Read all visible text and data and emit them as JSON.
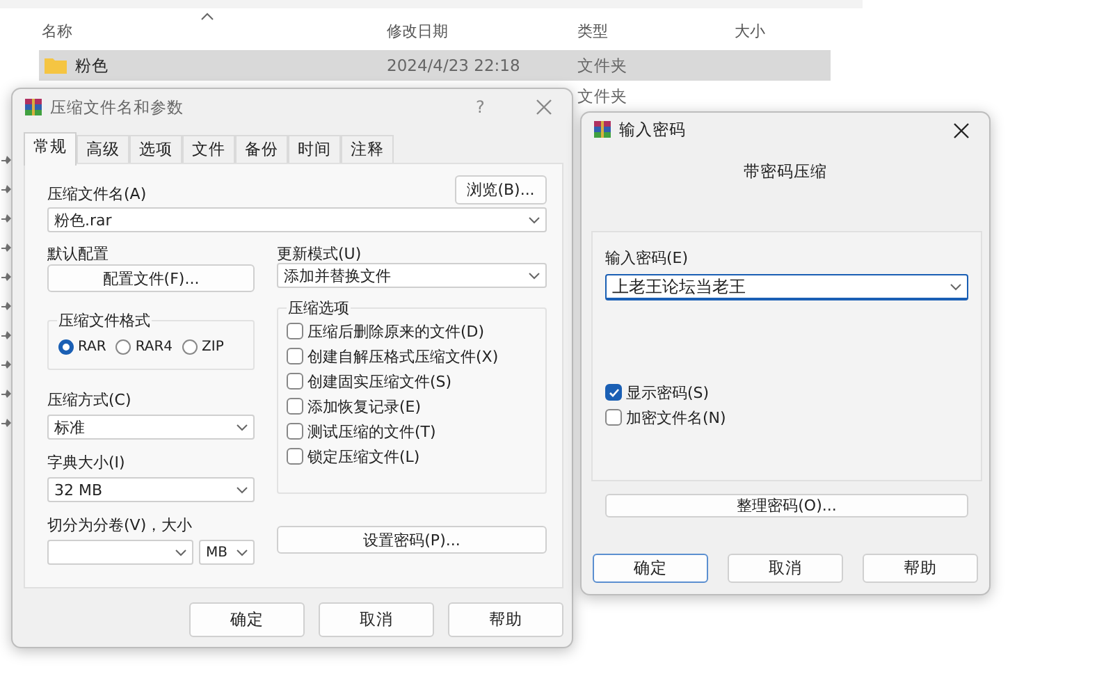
{
  "explorer": {
    "columns": [
      "名称",
      "修改日期",
      "类型",
      "大小"
    ],
    "rows": [
      {
        "name": "粉色",
        "modified": "2024/4/23 22:18",
        "type": "文件夹",
        "selected": true
      },
      {
        "type": "文件夹",
        "selected": false
      }
    ]
  },
  "archive_dialog": {
    "title": "压缩文件名和参数",
    "help_glyph": "?",
    "tabs": [
      {
        "label": "常规",
        "selected": true
      },
      {
        "label": "高级",
        "selected": false
      },
      {
        "label": "选项",
        "selected": false
      },
      {
        "label": "文件",
        "selected": false
      },
      {
        "label": "备份",
        "selected": false
      },
      {
        "label": "时间",
        "selected": false
      },
      {
        "label": "注释",
        "selected": false
      }
    ],
    "archive_name_label": "压缩文件名(A)",
    "browse_button": "浏览(B)...",
    "archive_name_value": "粉色.rar",
    "profile_label": "默认配置",
    "profile_button": "配置文件(F)...",
    "update_mode_label": "更新模式(U)",
    "update_mode_value": "添加并替换文件",
    "format_group": {
      "title": "压缩文件格式",
      "options": [
        {
          "label": "RAR",
          "selected": true
        },
        {
          "label": "RAR4",
          "selected": false
        },
        {
          "label": "ZIP",
          "selected": false
        }
      ]
    },
    "method_label": "压缩方式(C)",
    "method_value": "标准",
    "dictionary_label": "字典大小(I)",
    "dictionary_value": "32 MB",
    "split_label": "切分为分卷(V)，大小",
    "split_unit": "MB",
    "options_group": {
      "title": "压缩选项",
      "items": [
        {
          "label": "压缩后删除原来的文件(D)",
          "checked": false
        },
        {
          "label": "创建自解压格式压缩文件(X)",
          "checked": false
        },
        {
          "label": "创建固实压缩文件(S)",
          "checked": false
        },
        {
          "label": "添加恢复记录(E)",
          "checked": false
        },
        {
          "label": "测试压缩的文件(T)",
          "checked": false
        },
        {
          "label": "锁定压缩文件(L)",
          "checked": false
        }
      ]
    },
    "set_password_button": "设置密码(P)...",
    "buttons": [
      {
        "label": "确定",
        "focused": false
      },
      {
        "label": "取消",
        "focused": false
      },
      {
        "label": "帮助",
        "focused": false
      }
    ]
  },
  "password_dialog": {
    "title": "输入密码",
    "heading": "带密码压缩",
    "field_label": "输入密码(E)",
    "field_value": "上老王论坛当老王",
    "options": [
      {
        "label": "显示密码(S)",
        "checked": true
      },
      {
        "label": "加密文件名(N)",
        "checked": false
      }
    ],
    "organize_button": "整理密码(O)...",
    "buttons": [
      {
        "label": "确定",
        "focused": true
      },
      {
        "label": "取消",
        "focused": false
      },
      {
        "label": "帮助",
        "focused": false
      }
    ]
  }
}
